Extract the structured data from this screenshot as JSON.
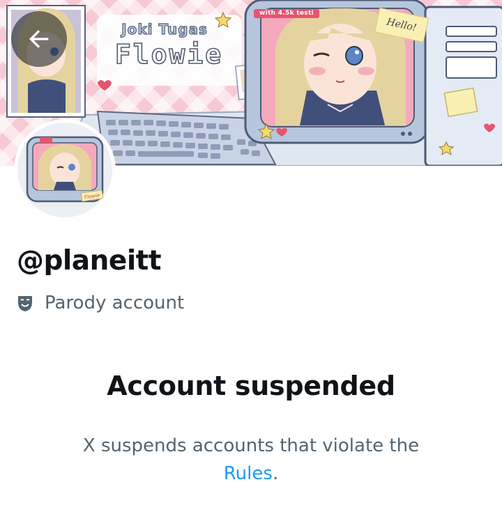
{
  "header": {
    "back_button_icon": "arrow-left-icon",
    "banner": {
      "title_sub": "Joki Tugas",
      "title_main": "Flowie",
      "tag": "with 4.5k testi",
      "note": "Hello!"
    }
  },
  "profile": {
    "avatar_caption": "Flowie",
    "handle": "@planeitt",
    "parody_icon": "theater-masks-icon",
    "parody_label": "Parody account"
  },
  "suspension": {
    "title": "Account suspended",
    "description_prefix": "X suspends accounts that violate the",
    "rules_link": "Rules",
    "description_suffix": "."
  },
  "colors": {
    "banner_pink": "#f7c9d4",
    "link_blue": "#1d9bf0",
    "text_primary": "#0f1419",
    "text_secondary": "#536471"
  }
}
